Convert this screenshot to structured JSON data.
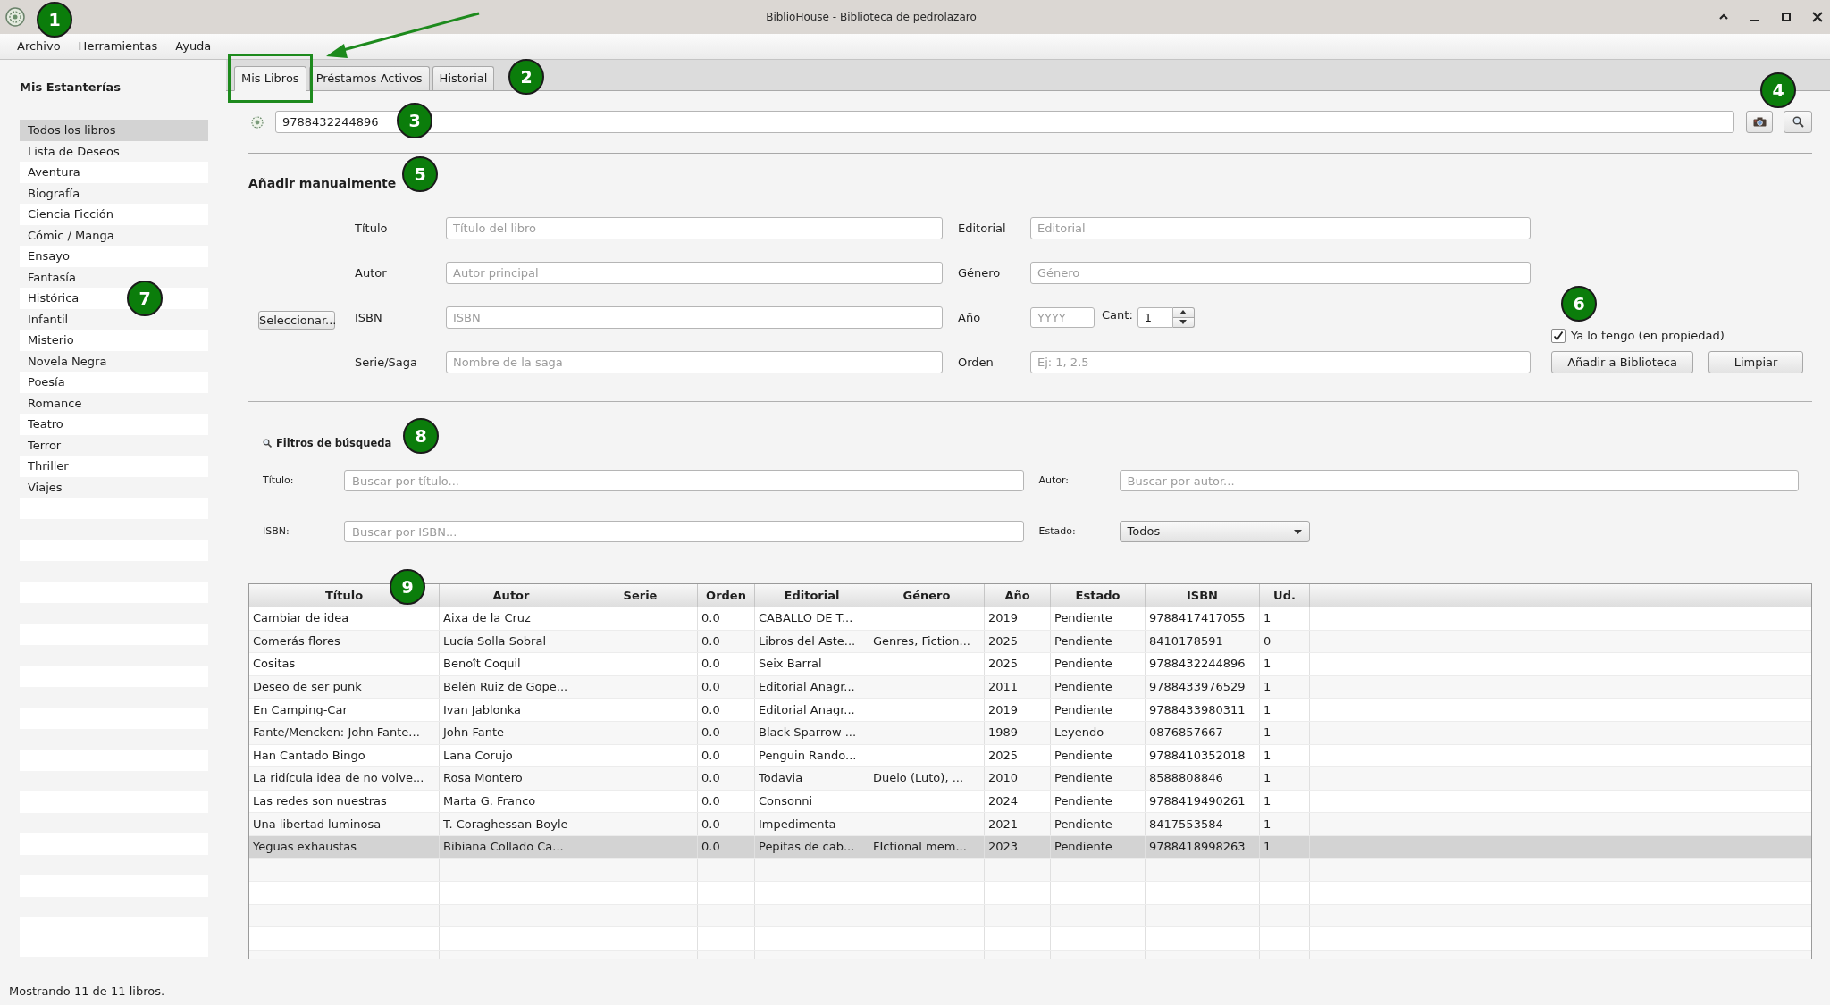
{
  "window": {
    "title": "BiblioHouse - Biblioteca de pedrolazaro"
  },
  "menu_bar": [
    "Archivo",
    "Herramientas",
    "Ayuda"
  ],
  "sidebar": {
    "title": "Mis Estanterías",
    "items": [
      {
        "label": "Todos los libros",
        "selected": true
      },
      {
        "label": "Lista de Deseos",
        "selected": false
      },
      {
        "label": "Aventura",
        "selected": false
      },
      {
        "label": "Biografía",
        "selected": false
      },
      {
        "label": "Ciencia Ficción",
        "selected": false
      },
      {
        "label": "Cómic / Manga",
        "selected": false
      },
      {
        "label": "Ensayo",
        "selected": false
      },
      {
        "label": "Fantasía",
        "selected": false
      },
      {
        "label": "Histórica",
        "selected": false
      },
      {
        "label": "Infantil",
        "selected": false
      },
      {
        "label": "Misterio",
        "selected": false
      },
      {
        "label": "Novela Negra",
        "selected": false
      },
      {
        "label": "Poesía",
        "selected": false
      },
      {
        "label": "Romance",
        "selected": false
      },
      {
        "label": "Teatro",
        "selected": false
      },
      {
        "label": "Terror",
        "selected": false
      },
      {
        "label": "Thriller",
        "selected": false
      },
      {
        "label": "Viajes",
        "selected": false
      }
    ]
  },
  "tabs": [
    {
      "label": "Mis Libros",
      "selected": true
    },
    {
      "label": "Préstamos Activos",
      "selected": false
    },
    {
      "label": "Historial",
      "selected": false
    }
  ],
  "isbn_lookup": {
    "value": "9788432244896"
  },
  "manual_entry": {
    "title": "Añadir manualmente",
    "select_button": "Seleccionar...",
    "fields": [
      {
        "kind": "text",
        "label": "Título",
        "placeholder": "Título del libro"
      },
      {
        "kind": "text",
        "label": "Editorial",
        "placeholder": "Editorial"
      },
      {
        "kind": "text",
        "label": "Autor",
        "placeholder": "Autor principal"
      },
      {
        "kind": "text",
        "label": "Género",
        "placeholder": "Género"
      },
      {
        "kind": "text",
        "label": "ISBN",
        "placeholder": "ISBN"
      },
      {
        "kind": "year_quantity",
        "label": "Año",
        "placeholder": "YYYY",
        "quantity_label": "Cant:",
        "quantity": "1"
      },
      {
        "kind": "text",
        "label": "Serie/Saga",
        "placeholder": "Nombre de la saga"
      },
      {
        "kind": "text",
        "label": "Orden",
        "placeholder": "Ej: 1, 2.5"
      }
    ],
    "owned_checkbox": {
      "label": "Ya lo tengo (en propiedad)",
      "checked": true
    },
    "buttons": [
      "Añadir a Biblioteca",
      "Limpiar"
    ]
  },
  "filters": {
    "title": "Filtros de búsqueda",
    "fields": [
      {
        "kind": "text",
        "label": "Título:",
        "placeholder": "Buscar por título..."
      },
      {
        "kind": "text",
        "label": "Autor:",
        "placeholder": "Buscar por autor..."
      },
      {
        "kind": "text",
        "label": "ISBN:",
        "placeholder": "Buscar por ISBN..."
      },
      {
        "kind": "dropdown",
        "label": "Estado:",
        "value": "Todos"
      }
    ]
  },
  "table": {
    "columns": [
      "Título",
      "Autor",
      "Serie",
      "Orden",
      "Editorial",
      "Género",
      "Año",
      "Estado",
      "ISBN",
      "Ud."
    ],
    "rows": [
      {
        "selected": false,
        "cells": [
          "Cambiar de idea",
          "Aixa de la Cruz",
          null,
          "0.0",
          "CABALLO DE T...",
          null,
          "2019",
          "Pendiente",
          "9788417417055",
          "1"
        ]
      },
      {
        "selected": false,
        "cells": [
          "Comerás flores",
          "Lucía Solla Sobral",
          null,
          "0.0",
          "Libros del Aste...",
          "Genres, Fiction...",
          "2025",
          "Pendiente",
          "8410178591",
          "0"
        ]
      },
      {
        "selected": false,
        "cells": [
          "Cositas",
          "Benoît Coquil",
          null,
          "0.0",
          "Seix Barral",
          null,
          "2025",
          "Pendiente",
          "9788432244896",
          "1"
        ]
      },
      {
        "selected": false,
        "cells": [
          "Deseo de ser punk",
          "Belén Ruiz de Gope...",
          null,
          "0.0",
          "Editorial Anagr...",
          null,
          "2011",
          "Pendiente",
          "9788433976529",
          "1"
        ]
      },
      {
        "selected": false,
        "cells": [
          "En Camping-Car",
          "Ivan Jablonka",
          null,
          "0.0",
          "Editorial Anagr...",
          null,
          "2019",
          "Pendiente",
          "9788433980311",
          "1"
        ]
      },
      {
        "selected": false,
        "cells": [
          "Fante/Mencken: John Fante...",
          "John Fante",
          null,
          "0.0",
          "Black Sparrow ...",
          null,
          "1989",
          "Leyendo",
          "0876857667",
          "1"
        ]
      },
      {
        "selected": false,
        "cells": [
          "Han Cantado Bingo",
          "Lana Corujo",
          null,
          "0.0",
          "Penguin Rando...",
          null,
          "2025",
          "Pendiente",
          "9788410352018",
          "1"
        ]
      },
      {
        "selected": false,
        "cells": [
          "La ridícula idea de no volve...",
          "Rosa Montero",
          null,
          "0.0",
          "Todavia",
          "Duelo (Luto), ...",
          "2010",
          "Pendiente",
          "8588808846",
          "1"
        ]
      },
      {
        "selected": false,
        "cells": [
          "Las redes son nuestras",
          "Marta G. Franco",
          null,
          "0.0",
          "Consonni",
          null,
          "2024",
          "Pendiente",
          "9788419490261",
          "1"
        ]
      },
      {
        "selected": false,
        "cells": [
          "Una libertad luminosa",
          "T. Coraghessan Boyle",
          null,
          "0.0",
          "Impedimenta",
          null,
          "2021",
          "Pendiente",
          "8417553584",
          "1"
        ]
      },
      {
        "selected": true,
        "cells": [
          "Yeguas exhaustas",
          "Bibiana Collado Ca...",
          null,
          "0.0",
          "Pepitas de cab...",
          "FIctional mem...",
          "2023",
          "Pendiente",
          "9788418998263",
          "1"
        ]
      }
    ]
  },
  "status_bar": "Mostrando 11 de 11 libros.",
  "callouts": [
    "1",
    "2",
    "3",
    "4",
    "5",
    "6",
    "7",
    "8",
    "9"
  ]
}
